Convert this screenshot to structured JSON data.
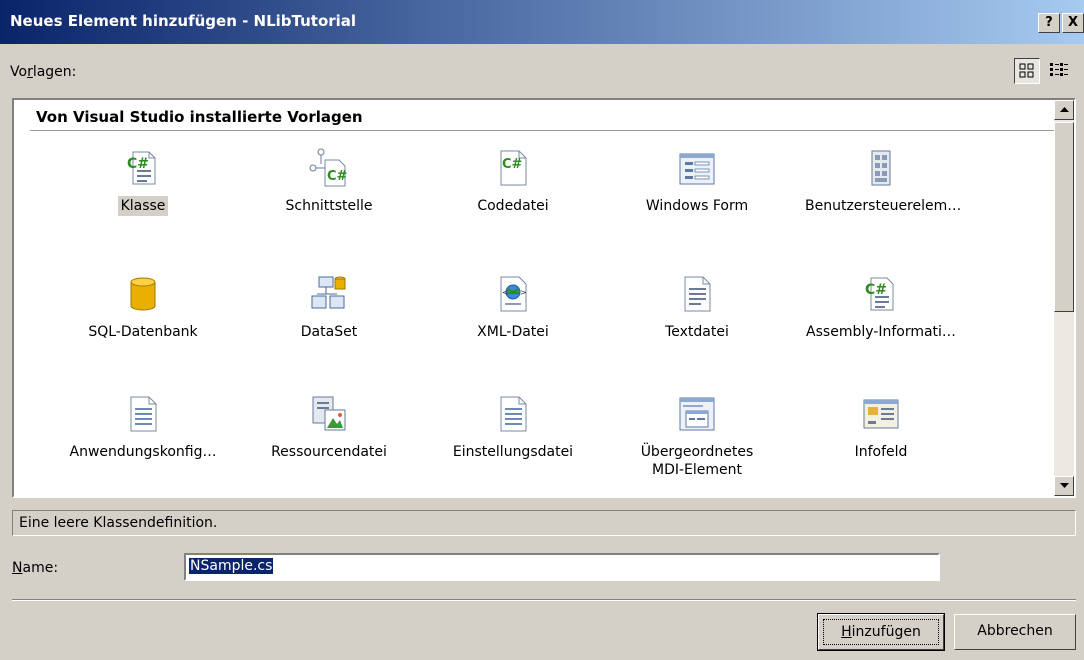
{
  "window": {
    "title": "Neues Element hinzufügen - NLibTutorial",
    "help_glyph": "?",
    "close_glyph": "X"
  },
  "templates": {
    "label_pre": "Vo",
    "label_accel": "r",
    "label_post": "lagen:",
    "view_modes": [
      "large-icons",
      "small-icons"
    ],
    "group_header": "Von Visual Studio installierte Vorlagen",
    "items": [
      {
        "label": "Klasse",
        "icon": "csharp-class-icon",
        "selected": true
      },
      {
        "label": "Schnittstelle",
        "icon": "csharp-interface-icon"
      },
      {
        "label": "Codedatei",
        "icon": "csharp-code-file-icon"
      },
      {
        "label": "Windows Form",
        "icon": "windows-form-icon"
      },
      {
        "label": "Benutzersteuerelem…",
        "icon": "user-control-icon"
      },
      {
        "label": "SQL-Datenbank",
        "icon": "database-icon"
      },
      {
        "label": "DataSet",
        "icon": "dataset-icon"
      },
      {
        "label": "XML-Datei",
        "icon": "xml-file-icon"
      },
      {
        "label": "Textdatei",
        "icon": "text-file-icon"
      },
      {
        "label": "Assembly-Informati…",
        "icon": "assembly-info-icon"
      },
      {
        "label": "Anwendungskonfig…",
        "icon": "config-file-icon"
      },
      {
        "label": "Ressourcendatei",
        "icon": "resource-file-icon"
      },
      {
        "label": "Einstellungsdatei",
        "icon": "settings-file-icon"
      },
      {
        "label": "Übergeordnetes",
        "label2": "MDI-Element",
        "icon": "mdi-parent-icon"
      },
      {
        "label": "Infofeld",
        "icon": "about-box-icon"
      }
    ]
  },
  "description": "Eine leere Klassendefinition.",
  "name_field": {
    "label_accel": "N",
    "label_post": "ame:",
    "value": "NSample.cs"
  },
  "buttons": {
    "add_accel": "H",
    "add_post": "inzufügen",
    "cancel": "Abbrechen"
  },
  "colors": {
    "title_start": "#0a246a",
    "title_end": "#a6caf0",
    "face": "#d4d0c8",
    "csharp_green": "#2e8b1e",
    "selection": "#0a246a"
  }
}
